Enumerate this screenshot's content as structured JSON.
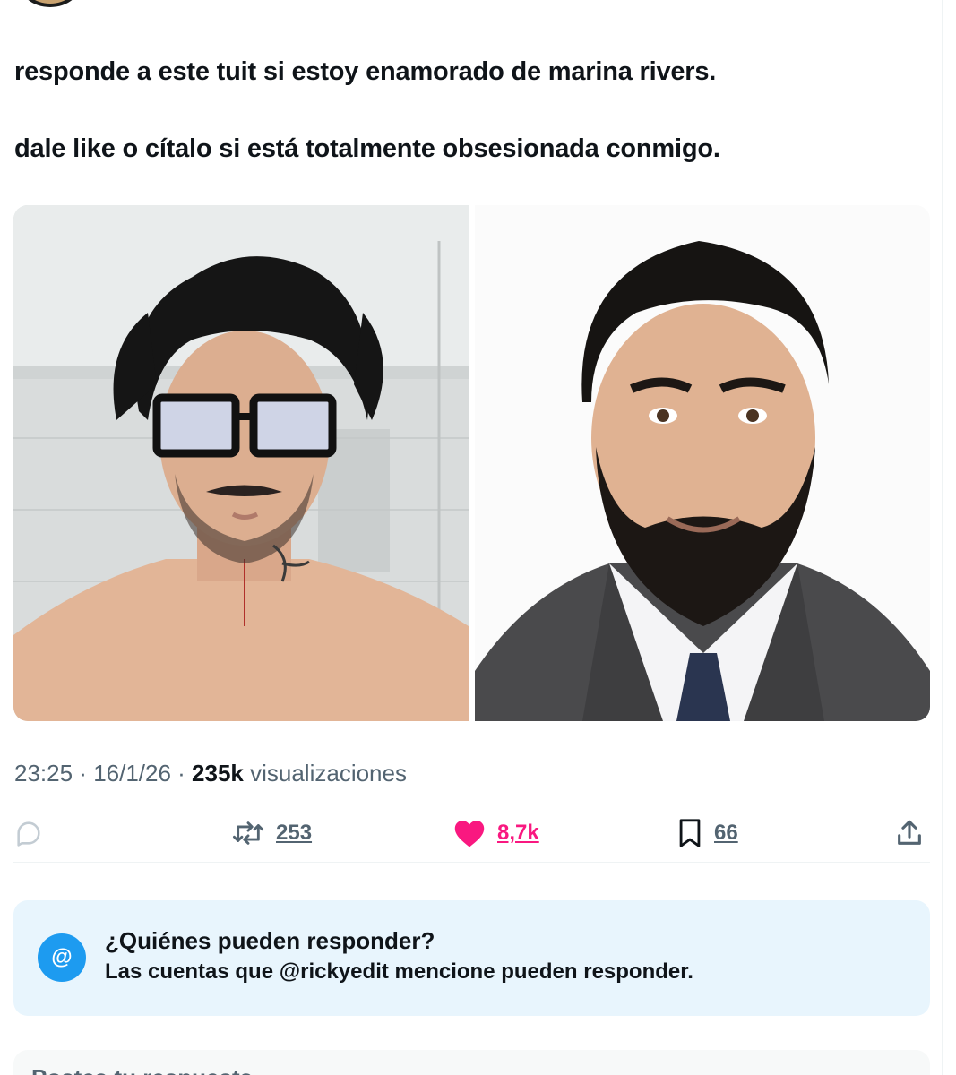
{
  "tweet": {
    "line1": "responde a este tuit si estoy enamorado de marina rivers.",
    "line2": "dale like o cítalo si está totalmente obsesionada conmigo."
  },
  "meta": {
    "time": "23:25",
    "sep1": " · ",
    "date": "16/1/26",
    "sep2": " · ",
    "views_count": "235k",
    "views_label": " visualizaciones"
  },
  "actions": {
    "reply_icon": "reply-icon",
    "retweet_count": "253",
    "like_count": "8,7k",
    "bookmark_count": "66",
    "share_icon": "share-icon"
  },
  "reply_restriction": {
    "badge": "@",
    "title": "¿Quiénes pueden responder?",
    "subtitle": "Las cuentas que @rickyedit mencione pueden responder."
  },
  "compose": {
    "placeholder": "Postea tu respuesta"
  },
  "colors": {
    "like": "#f91880",
    "accent": "#1d9bf0",
    "muted": "#536471",
    "reply_box_bg": "#e8f5fd"
  }
}
